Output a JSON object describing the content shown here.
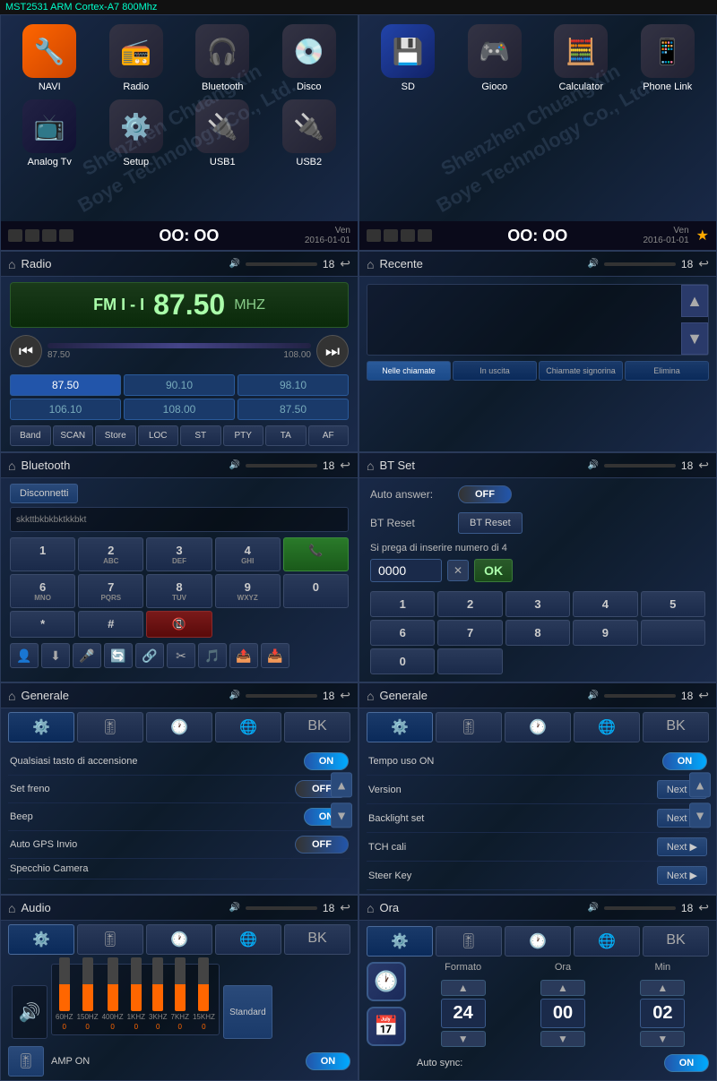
{
  "top_bar": {
    "label": "MST2531 ARM Cortex-A7 800Mhz"
  },
  "watermark": "Shenzhen ChuangXin Boye Technology Co., Ltd.",
  "row1": {
    "left": {
      "apps": [
        {
          "id": "navi",
          "label": "NAVI",
          "icon": "🔧",
          "class": "icon-navi"
        },
        {
          "id": "radio",
          "label": "Radio",
          "icon": "📻",
          "class": "icon-radio"
        },
        {
          "id": "bluetooth",
          "label": "Bluetooth",
          "icon": "🎧",
          "class": "icon-bluetooth"
        },
        {
          "id": "disco",
          "label": "Disco",
          "icon": "💿",
          "class": "icon-disco"
        },
        {
          "id": "atv",
          "label": "Analog Tv",
          "icon": "📺",
          "class": "icon-atv"
        },
        {
          "id": "setup",
          "label": "Setup",
          "icon": "⚙️",
          "class": "icon-setup"
        },
        {
          "id": "usb1",
          "label": "USB1",
          "icon": "🔌",
          "class": "icon-usb1"
        },
        {
          "id": "usb2",
          "label": "USB2",
          "icon": "🔌",
          "class": "icon-usb2"
        }
      ],
      "status": {
        "time": "OO: OO",
        "date": "Ven\n2016-01-01"
      }
    },
    "right": {
      "apps": [
        {
          "id": "sd",
          "label": "SD",
          "icon": "💾",
          "class": "icon-sd"
        },
        {
          "id": "gioco",
          "label": "Gioco",
          "icon": "🎮",
          "class": "icon-gioco"
        },
        {
          "id": "calc",
          "label": "Calculator",
          "icon": "🧮",
          "class": "icon-calc"
        },
        {
          "id": "phone",
          "label": "Phone Link",
          "icon": "📱",
          "class": "icon-phone"
        }
      ],
      "status": {
        "time": "OO: OO",
        "date": "Ven\n2016-01-01"
      }
    }
  },
  "row2": {
    "left": {
      "header": {
        "title": "Radio",
        "vol": "🔊",
        "num": "18"
      },
      "band": "FM I - I",
      "freq": "87.50",
      "mhz": "MHZ",
      "range_min": "87.50",
      "range_max": "108.00",
      "presets": [
        "87.50",
        "90.10",
        "98.10",
        "106.10",
        "108.00",
        "87.50"
      ],
      "controls": [
        "Band",
        "SCAN",
        "Store",
        "LOC",
        "ST",
        "PTY",
        "TA",
        "AF"
      ]
    },
    "right": {
      "header": {
        "title": "Recente",
        "vol": "🔊",
        "num": "18"
      },
      "tabs": [
        "Nelle chiamate",
        "In uscita",
        "Chiamate signorina",
        "Elimina"
      ]
    }
  },
  "row3": {
    "left": {
      "header": {
        "title": "Bluetooth",
        "num": "18"
      },
      "disconnect_label": "Disconnetti",
      "device_text": "skkttbkbkbktkkbkt",
      "numpad": [
        {
          "num": "1",
          "sub": ""
        },
        {
          "num": "2",
          "sub": "ABC"
        },
        {
          "num": "3",
          "sub": "DEF"
        },
        {
          "num": "4",
          "sub": "GHI"
        },
        {
          "num": "call_green",
          "sub": ""
        },
        {
          "num": "6",
          "sub": "MNO"
        },
        {
          "num": "7",
          "sub": "PQRS"
        },
        {
          "num": "8",
          "sub": "TUV"
        },
        {
          "num": "9",
          "sub": "WXYZ"
        },
        {
          "num": "0",
          "sub": ""
        },
        {
          "num": "*",
          "sub": ""
        },
        {
          "num": "#",
          "sub": ""
        },
        {
          "num": "call_red",
          "sub": ""
        }
      ]
    },
    "right": {
      "header": {
        "title": "BT Set",
        "num": "18"
      },
      "auto_answer_label": "Auto answer:",
      "auto_answer_value": "OFF",
      "bt_reset_label": "BT Reset",
      "bt_reset_btn": "BT Reset",
      "hint": "Si prega di inserire numero di 4",
      "pin_value": "0000",
      "numpad_btset": [
        "1",
        "2",
        "3",
        "4",
        "5",
        "6",
        "7",
        "8",
        "9",
        "",
        "0",
        ""
      ]
    }
  },
  "row4": {
    "left": {
      "header": {
        "title": "Generale",
        "num": "18"
      },
      "rows": [
        {
          "label": "Qualsiasi tasto di accensione",
          "value": "ON",
          "type": "toggle_on"
        },
        {
          "label": "Set freno",
          "value": "OFF",
          "type": "toggle_off"
        },
        {
          "label": "Beep",
          "value": "ON",
          "type": "toggle_on"
        },
        {
          "label": "Auto GPS Invio",
          "value": "OFF",
          "type": "toggle_off"
        },
        {
          "label": "Specchio Camera",
          "value": "",
          "type": "blank"
        }
      ]
    },
    "right": {
      "header": {
        "title": "Generale",
        "num": "18"
      },
      "rows": [
        {
          "label": "Tempo uso ON",
          "value": "ON",
          "type": "toggle_on"
        },
        {
          "label": "Version",
          "value": "Next",
          "type": "next"
        },
        {
          "label": "Backlight set",
          "value": "Next",
          "type": "next"
        },
        {
          "label": "TCH cali",
          "value": "Next",
          "type": "next"
        },
        {
          "label": "Steer Key",
          "value": "Next",
          "type": "next"
        }
      ]
    }
  },
  "row5": {
    "left": {
      "header": {
        "title": "Audio",
        "num": "18"
      },
      "bands": [
        "60HZ",
        "150HZ",
        "400HZ",
        "1KHZ",
        "3KHZ",
        "7KHZ",
        "15KHZ"
      ],
      "band_values": [
        0,
        0,
        0,
        0,
        0,
        0,
        0
      ],
      "amp_label": "AMP ON",
      "amp_value": "ON"
    },
    "right": {
      "header": {
        "title": "Ora",
        "num": "18"
      },
      "formato_label": "Formato",
      "ora_label": "Ora",
      "min_label": "Min",
      "formato_value": "24",
      "ora_value": "00",
      "min_value": "02",
      "autosync_label": "Auto sync:",
      "autosync_value": "ON"
    }
  }
}
